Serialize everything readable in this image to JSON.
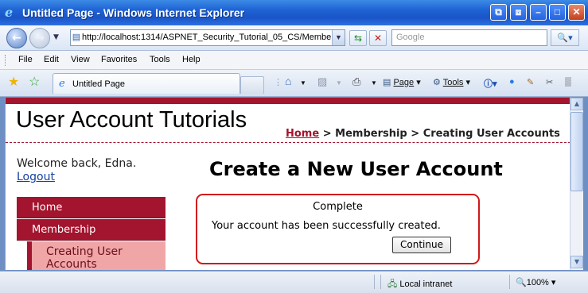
{
  "window": {
    "title": "Untitled Page - Windows Internet Explorer",
    "controls": {
      "restore": "⧉",
      "minimize": "–",
      "maximize": "□",
      "close": "✕"
    }
  },
  "address_bar": {
    "url": "http://localhost:1314/ASPNET_Security_Tutorial_05_CS/Membe",
    "search_placeholder": "Google"
  },
  "menu": {
    "items": [
      {
        "label": "File"
      },
      {
        "label": "Edit"
      },
      {
        "label": "View"
      },
      {
        "label": "Favorites"
      },
      {
        "label": "Tools"
      },
      {
        "label": "Help"
      }
    ]
  },
  "tabs": {
    "active_tab_label": "Untitled Page"
  },
  "command_bar": {
    "page_label": "Page",
    "tools_label": "Tools"
  },
  "site": {
    "title": "User Account Tutorials",
    "breadcrumb": {
      "home": "Home",
      "separator": " > ",
      "section": "Membership",
      "current": "Creating User Accounts"
    },
    "welcome_text": "Welcome back, Edna.",
    "logout_label": "Logout",
    "nav": {
      "items": [
        {
          "label": "Home"
        },
        {
          "label": "Membership"
        }
      ],
      "sub_item": "Creating User Accounts"
    },
    "heading": "Create a New User Account",
    "complete_step": {
      "title": "Complete",
      "message": "Your account has been successfully created.",
      "continue_label": "Continue"
    }
  },
  "status_bar": {
    "zone": "Local intranet",
    "zoom": "100%"
  },
  "colors": {
    "accent": "#a3142e",
    "sub_nav_bg": "#f0a6a6",
    "link": "#1540a0",
    "box_border": "#d21818"
  }
}
